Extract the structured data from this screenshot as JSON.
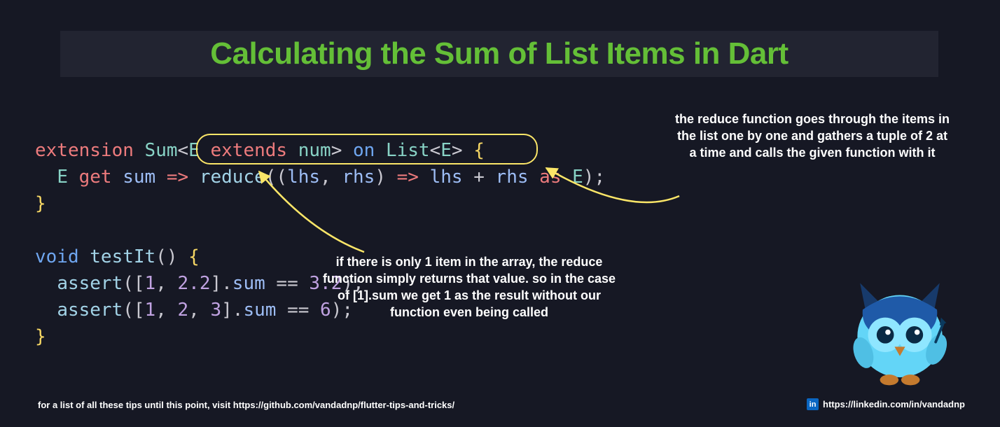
{
  "title": "Calculating the Sum of List Items in Dart",
  "code": {
    "l1": {
      "a": "extension",
      "b": "Sum",
      "c": "<",
      "d": "E",
      "e": "extends",
      "f": "num",
      "g": ">",
      "h": "on",
      "i": "List",
      "j": "<",
      "k": "E",
      "l": ">",
      "m": "{"
    },
    "l2": {
      "a": "E",
      "b": "get",
      "c": "sum",
      "d": "=>",
      "e": "reduce",
      "f": "((",
      "g": "lhs",
      "h": ",",
      "i": "rhs",
      "j": ")",
      "k": "=>",
      "l": "lhs",
      "m": "+",
      "n": "rhs",
      "o": "as",
      "p": "E",
      "q": ");"
    },
    "l3": {
      "a": "}"
    },
    "l5": {
      "a": "void",
      "b": "testIt",
      "c": "()",
      "d": "{"
    },
    "l6": {
      "a": "assert",
      "b": "([",
      "c": "1",
      "d": ",",
      "e": "2.2",
      "f": "].",
      "g": "sum",
      "h": "==",
      "i": "3.2",
      "j": ");"
    },
    "l7": {
      "a": "assert",
      "b": "([",
      "c": "1",
      "d": ",",
      "e": "2",
      "f": ",",
      "g": "3",
      "h": "].",
      "i": "sum",
      "j": "==",
      "k": "6",
      "l": ");"
    },
    "l8": {
      "a": "}"
    }
  },
  "annotations": {
    "right": "the reduce function goes through the items in the list one by one and gathers a tuple of 2 at a time and calls the given function with it",
    "bottom": "if there is only 1 item in the array, the reduce function simply returns that value. so in the case of [1].sum we get 1 as the result without our function even being called"
  },
  "footer": {
    "left": "for a list of all these tips until this point, visit https://github.com/vandadnp/flutter-tips-and-tricks/",
    "right": "https://linkedin.com/in/vandadnp",
    "in_label": "in"
  },
  "colors": {
    "accent_yellow": "#fbe668",
    "title_green": "#64bf37"
  }
}
